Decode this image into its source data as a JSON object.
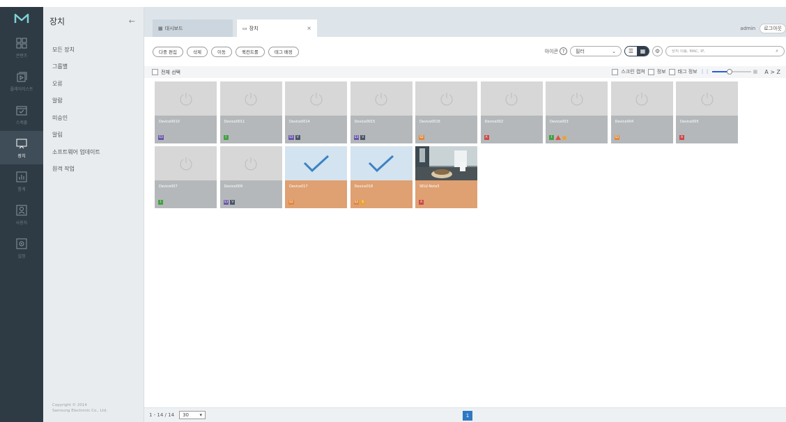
{
  "nav": {
    "items": [
      {
        "id": "content",
        "label": "콘텐츠",
        "icon": "grid-icon"
      },
      {
        "id": "playlist",
        "label": "플레이리스트",
        "icon": "playlist-icon"
      },
      {
        "id": "schedule",
        "label": "스케줄",
        "icon": "calendar-icon"
      },
      {
        "id": "device",
        "label": "장치",
        "icon": "monitor-icon"
      },
      {
        "id": "stats",
        "label": "통계",
        "icon": "chart-icon"
      },
      {
        "id": "user",
        "label": "사용자",
        "icon": "user-icon"
      },
      {
        "id": "settings",
        "label": "설정",
        "icon": "gear-icon"
      }
    ],
    "active": "device"
  },
  "subnav": {
    "title": "장치",
    "back_icon": "arrow-left-icon",
    "items": [
      "모든 장치",
      "그룹별",
      "오류",
      "알람",
      "미승인",
      "알림",
      "소프트웨어 업데이트",
      "원격 작업"
    ],
    "copyright_line1": "Copyright © 2014",
    "copyright_line2": "Samsung Electronic Co., Ltd."
  },
  "tabs": [
    {
      "label": "대시보드",
      "icon": "dashboard-icon"
    },
    {
      "label": "장치",
      "icon": "monitor-icon",
      "close": "×"
    }
  ],
  "user": {
    "name": "admin",
    "logout": "로그아웃"
  },
  "toolbar": {
    "buttons": [
      "다중 편집",
      "삭제",
      "이동",
      "퀵컨트롤",
      "태그 배정"
    ],
    "icon_label": "아이콘",
    "help": "?",
    "filter_label": "필터",
    "search_placeholder": "장치 이름, MAC, IP,"
  },
  "selectbar": {
    "select_all": "전체 선택",
    "screen_capture": "스크린 캡쳐",
    "info": "정보",
    "tag_info": "태그 정보",
    "sort": "A > Z",
    "size_level": 0.45
  },
  "devices": [
    {
      "name": "Device0010",
      "style": "gray",
      "tags": [
        "S3"
      ]
    },
    {
      "name": "Device0011",
      "style": "gray",
      "tags": [
        "I"
      ]
    },
    {
      "name": "Device0014",
      "style": "gray",
      "tags": [
        "S3",
        "V"
      ]
    },
    {
      "name": "Device0015",
      "style": "gray",
      "tags": [
        "S3",
        "V"
      ]
    },
    {
      "name": "Device0016",
      "style": "gray",
      "tags": [
        "S2"
      ]
    },
    {
      "name": "Device002",
      "style": "gray",
      "tags": [
        "A"
      ]
    },
    {
      "name": "Device003",
      "style": "gray",
      "tags": [
        "I",
        "warn",
        "dot"
      ]
    },
    {
      "name": "Device004",
      "style": "gray",
      "tags": [
        "S2"
      ]
    },
    {
      "name": "Device005",
      "style": "gray",
      "tags": [
        "A"
      ]
    },
    {
      "name": "Device007",
      "style": "gray",
      "tags": [
        "I"
      ]
    },
    {
      "name": "Device009",
      "style": "gray",
      "tags": [
        "S3",
        "V"
      ]
    },
    {
      "name": "Device017",
      "style": "orange-selected",
      "tags": [
        "S2"
      ]
    },
    {
      "name": "Device018",
      "style": "orange-selected",
      "tags": [
        "S2",
        "S"
      ]
    },
    {
      "name": "SELV-Note5",
      "style": "orange-photo",
      "tags": [
        "A"
      ]
    }
  ],
  "footer": {
    "range": "1 - 14 / 14",
    "per_page": "30",
    "page": "1"
  }
}
